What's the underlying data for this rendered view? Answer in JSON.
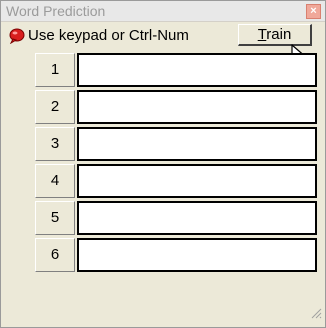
{
  "window": {
    "title": "Word Prediction",
    "close_icon": "close-x-icon"
  },
  "instructions": {
    "icon": "red-bubble-icon",
    "text": "Use keypad or Ctrl-Num"
  },
  "train_button": {
    "mnemonic": "T",
    "rest": "rain"
  },
  "predictions": [
    {
      "key": "1",
      "word": ""
    },
    {
      "key": "2",
      "word": ""
    },
    {
      "key": "3",
      "word": ""
    },
    {
      "key": "4",
      "word": ""
    },
    {
      "key": "5",
      "word": ""
    },
    {
      "key": "6",
      "word": ""
    }
  ],
  "colors": {
    "window_bg": "#ece9d8",
    "title_text": "#9b9b9b",
    "close_button": "#f0a89a"
  }
}
